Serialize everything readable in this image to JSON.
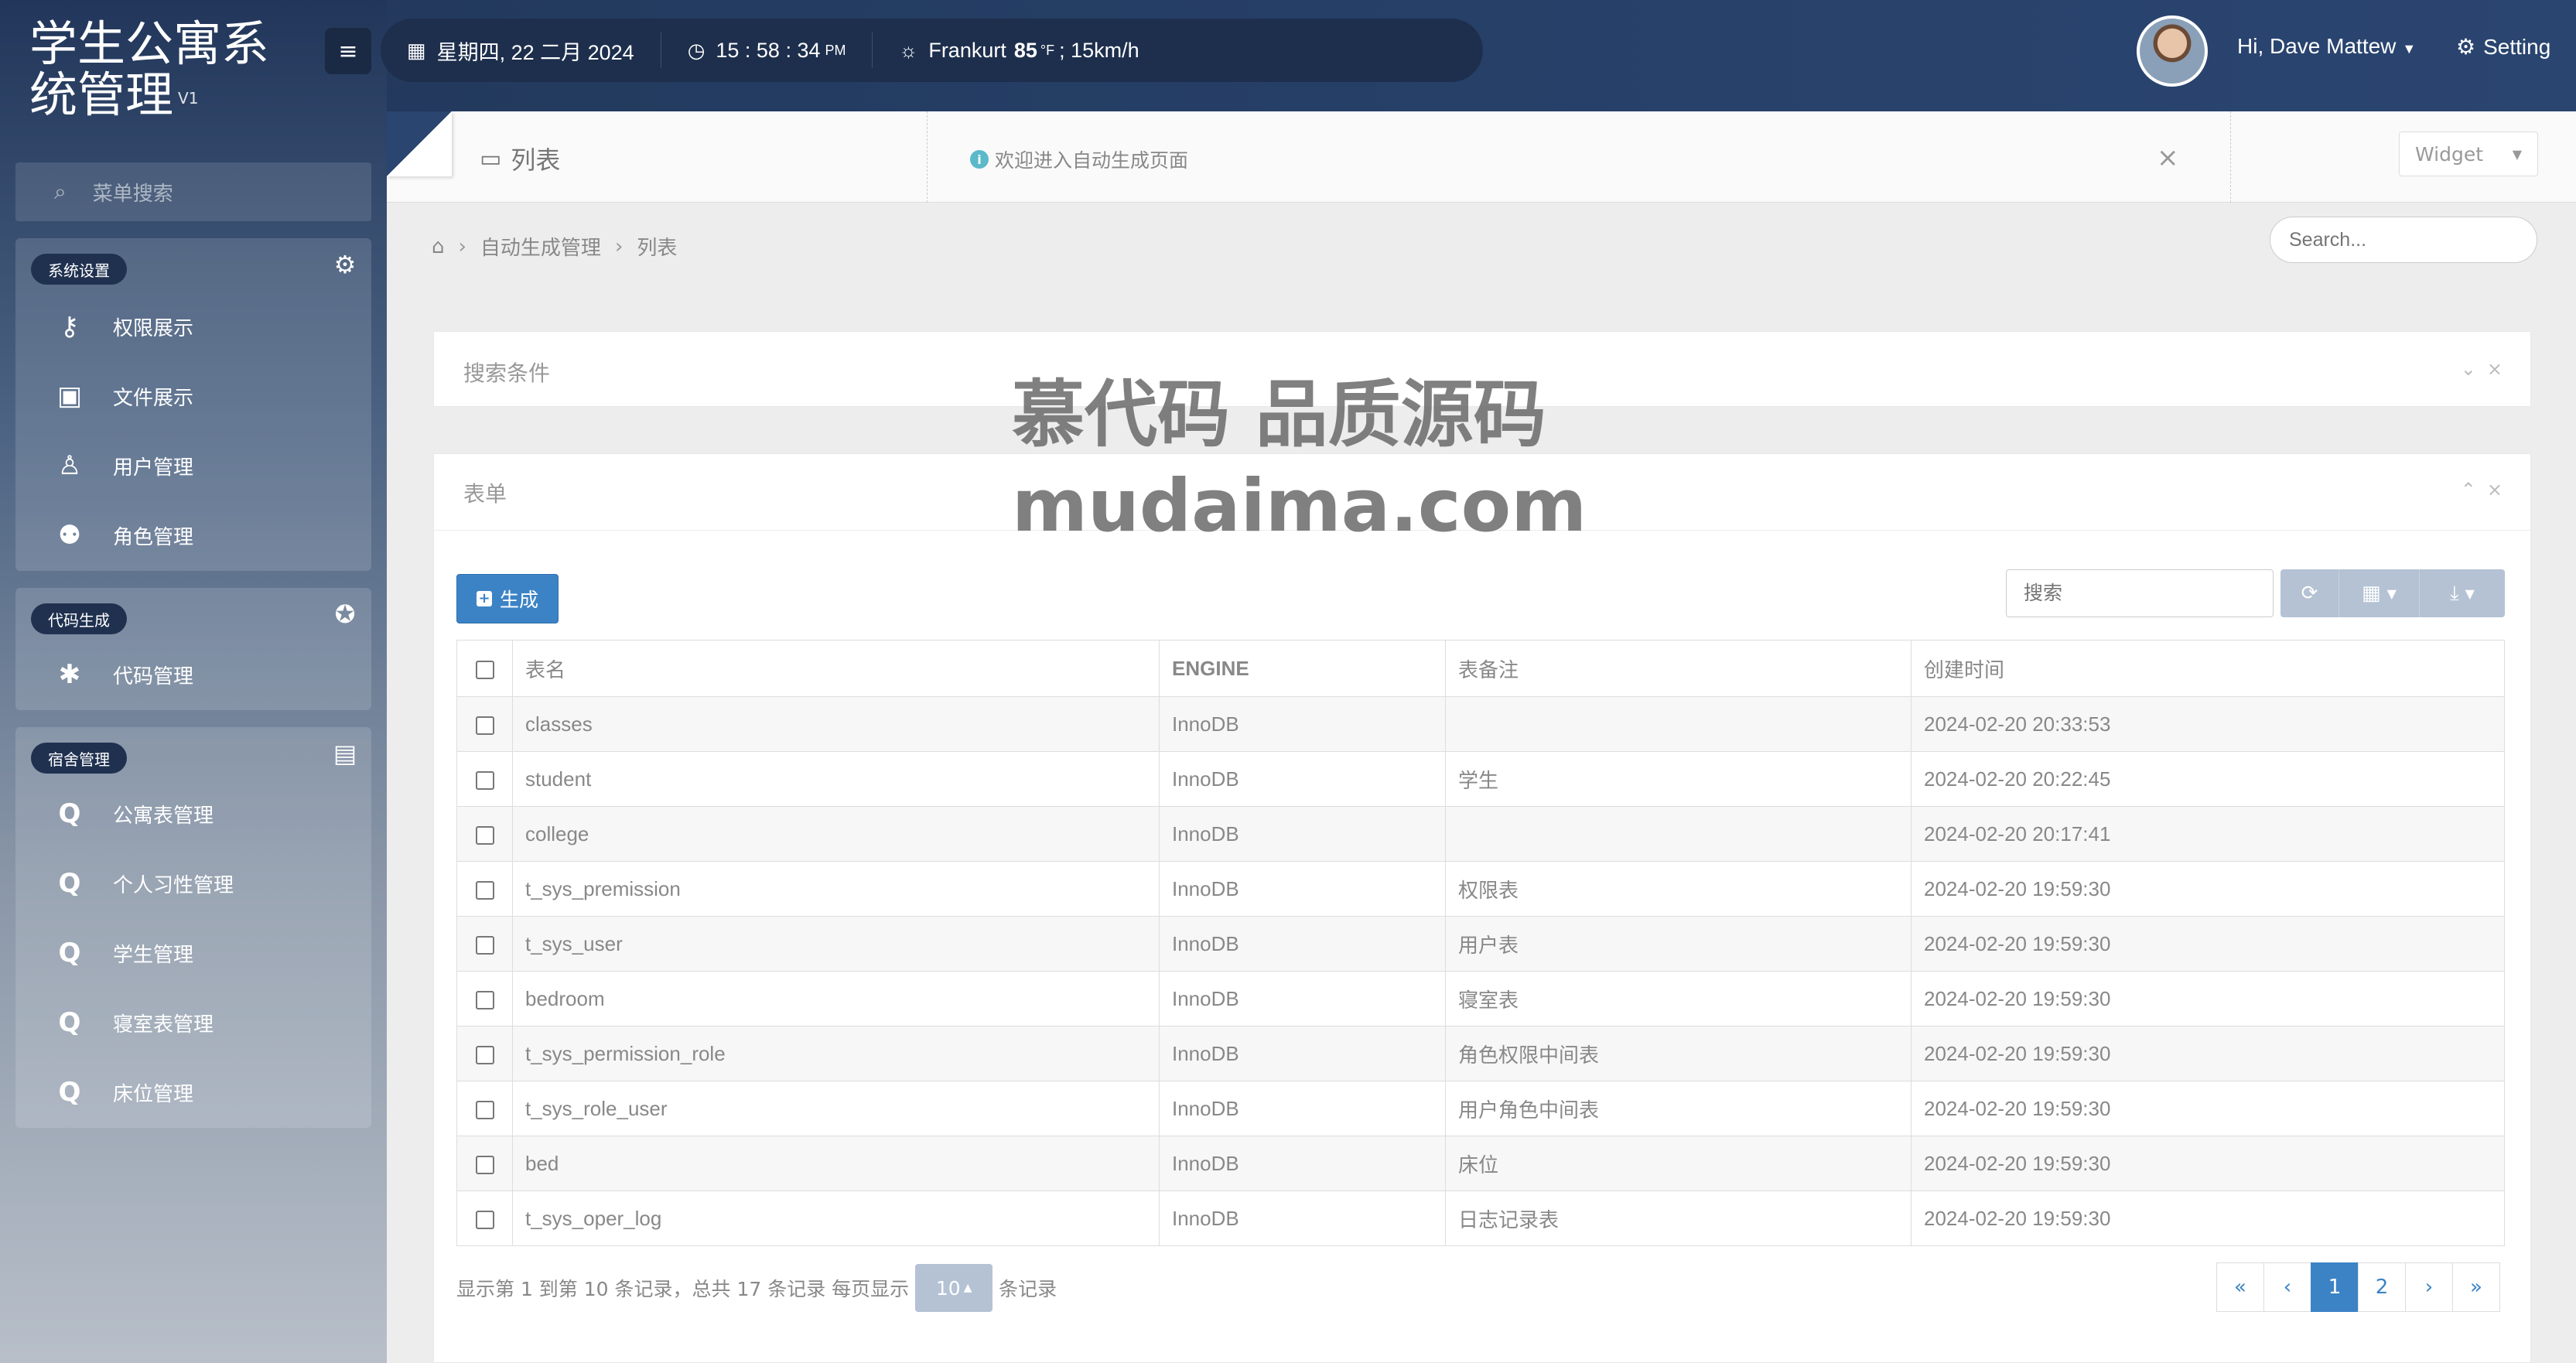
{
  "app": {
    "title": "学生公寓系统管理",
    "version": "V1"
  },
  "topbar": {
    "date": "星期四, 22 二月 2024",
    "time": "15 : 58 : 34",
    "time_suffix": "PM",
    "weather_city": "Frankurt",
    "weather_temp": "85",
    "weather_unit": "°F",
    "weather_wind": "; 15km/h",
    "user_greeting": "Hi, Dave Mattew",
    "setting_label": "Setting"
  },
  "sidebar": {
    "search_placeholder": "菜单搜索",
    "groups": [
      {
        "tag": "系统设置",
        "items": [
          {
            "label": "权限展示",
            "icon": "key-icon"
          },
          {
            "label": "文件展示",
            "icon": "image-file-icon"
          },
          {
            "label": "用户管理",
            "icon": "user-icon"
          },
          {
            "label": "角色管理",
            "icon": "users-icon"
          }
        ]
      },
      {
        "tag": "代码生成",
        "items": [
          {
            "label": "代码管理",
            "icon": "bug-icon"
          }
        ]
      },
      {
        "tag": "宿舍管理",
        "items": [
          {
            "label": "公寓表管理",
            "icon": "q-icon"
          },
          {
            "label": "个人习性管理",
            "icon": "q-icon"
          },
          {
            "label": "学生管理",
            "icon": "q-icon"
          },
          {
            "label": "寝室表管理",
            "icon": "q-icon"
          },
          {
            "label": "床位管理",
            "icon": "q-icon"
          }
        ]
      }
    ]
  },
  "header": {
    "list_title": "列表",
    "welcome": "欢迎进入自动生成页面",
    "widget_label": "Widget",
    "close_glyph": "×"
  },
  "breadcrumb": {
    "items": [
      "自动生成管理",
      "列表"
    ],
    "search_placeholder": "Search..."
  },
  "search_card": {
    "title": "搜索条件"
  },
  "form_card": {
    "title": "表单",
    "generate_label": "生成",
    "table_search_placeholder": "搜索",
    "columns": [
      "表名",
      "ENGINE",
      "表备注",
      "创建时间"
    ],
    "rows": [
      {
        "name": "classes",
        "engine": "InnoDB",
        "comment": "",
        "created": "2024-02-20 20:33:53"
      },
      {
        "name": "student",
        "engine": "InnoDB",
        "comment": "学生",
        "created": "2024-02-20 20:22:45"
      },
      {
        "name": "college",
        "engine": "InnoDB",
        "comment": "",
        "created": "2024-02-20 20:17:41"
      },
      {
        "name": "t_sys_premission",
        "engine": "InnoDB",
        "comment": "权限表",
        "created": "2024-02-20 19:59:30"
      },
      {
        "name": "t_sys_user",
        "engine": "InnoDB",
        "comment": "用户表",
        "created": "2024-02-20 19:59:30"
      },
      {
        "name": "bedroom",
        "engine": "InnoDB",
        "comment": "寝室表",
        "created": "2024-02-20 19:59:30"
      },
      {
        "name": "t_sys_permission_role",
        "engine": "InnoDB",
        "comment": "角色权限中间表",
        "created": "2024-02-20 19:59:30"
      },
      {
        "name": "t_sys_role_user",
        "engine": "InnoDB",
        "comment": "用户角色中间表",
        "created": "2024-02-20 19:59:30"
      },
      {
        "name": "bed",
        "engine": "InnoDB",
        "comment": "床位",
        "created": "2024-02-20 19:59:30"
      },
      {
        "name": "t_sys_oper_log",
        "engine": "InnoDB",
        "comment": "日志记录表",
        "created": "2024-02-20 19:59:30"
      }
    ],
    "pagination_text_before": "显示第 1 到第 10 条记录，总共 17 条记录 每页显示",
    "page_size": "10",
    "pagination_text_after": "条记录",
    "pages": [
      "«",
      "‹",
      "1",
      "2",
      "›",
      "»"
    ],
    "active_page": "1"
  },
  "watermark": {
    "line1": "慕代码 品质源码",
    "line2": "mudaima.com"
  },
  "colors": {
    "primary": "#3c83c6",
    "topbar": "#27416a",
    "tools": "#b4c2d4"
  }
}
